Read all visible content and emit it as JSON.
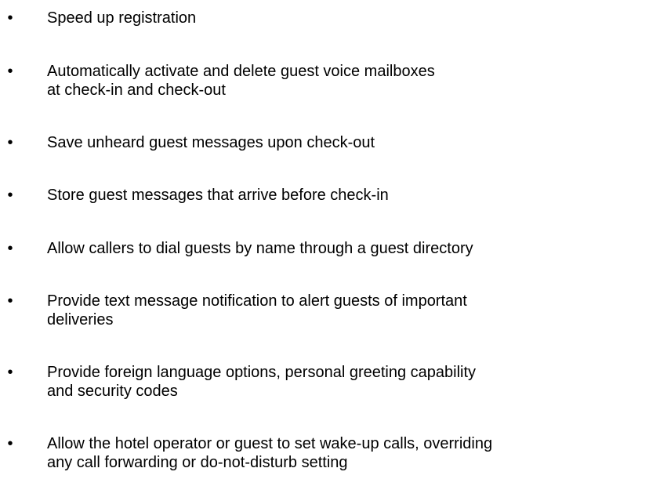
{
  "document": {
    "bullet_glyph": "•",
    "items": [
      "Speed up registration",
      "Automatically activate and delete guest voice mailboxes\nat check-in and check-out",
      "Save unheard guest messages upon check-out",
      "Store guest messages that arrive before check-in",
      "Allow callers to dial guests by name through a guest directory",
      "Provide text message notification to alert guests of important\ndeliveries",
      "Provide foreign language options, personal greeting capability\nand security codes",
      "Allow the hotel operator or guest to set wake-up calls, overriding\nany call forwarding or do-not-disturb setting"
    ]
  }
}
